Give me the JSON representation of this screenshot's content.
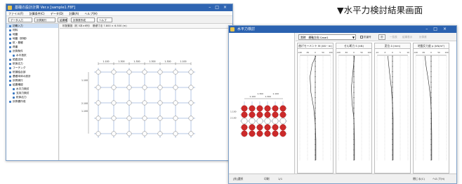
{
  "caption": "▼水平力検討結果画面",
  "main_window": {
    "title": "基礎の設計計算 Ver.x  [sample1.F8F]",
    "menu": [
      "ファイル(F)",
      "計算条件(C)",
      "データ(D)",
      "計算(A)",
      "ヘルプ(H)"
    ],
    "toolbar": [
      "データ入力",
      "計算実行",
      "結果確認",
      "計算書作成",
      "ヘルプ"
    ],
    "tree": [
      {
        "label": "初期入力",
        "selected": true,
        "indent": false
      },
      {
        "label": "材料",
        "indent": false
      },
      {
        "label": "地盤",
        "indent": false
      },
      {
        "label": "地盤（詳細）",
        "indent": false
      },
      {
        "label": "杭・基礎",
        "indent": false
      },
      {
        "label": "荷重",
        "indent": false
      },
      {
        "label": "計算条件",
        "indent": false
      },
      {
        "label": "水平抵抗",
        "indent": true
      },
      {
        "label": "鉛直支持",
        "indent": false
      },
      {
        "label": "杭体応力",
        "indent": false
      },
      {
        "label": "フーチング",
        "indent": false
      },
      {
        "label": "杭頭結合部",
        "indent": false
      },
      {
        "label": "基礎本体の設計",
        "indent": false
      },
      {
        "label": "計算実行",
        "indent": false
      },
      {
        "label": "結果確認",
        "indent": false
      },
      {
        "label": "水平力検討",
        "indent": true
      },
      {
        "label": "支持力検討",
        "indent": true
      },
      {
        "label": "杭体応力",
        "indent": true
      },
      {
        "label": "計算書作成",
        "indent": false
      }
    ],
    "canvas_header": "杭配置図（杭 5本×6列）　基礎寸法 7.800 × 6.500 (m)",
    "plan": {
      "top_dims": [
        "1.100",
        "1.300",
        "1.300",
        "1.300",
        "1.300",
        "1.100"
      ],
      "left_dims": [
        "1.100",
        "2.100",
        "1.100"
      ]
    }
  },
  "result_window": {
    "title": "水平力検討",
    "select_value": "常時　橋軸方向 Case1",
    "checkbox_label": "杭番号",
    "buttons": [
      "図",
      "一覧表",
      "結果表示",
      "計算書"
    ],
    "panels": [
      {
        "title": "曲げモーメント M (kN・m)",
        "scale": [
          "-100",
          "-50",
          "0",
          "50",
          "100"
        ]
      },
      {
        "title": "せん断力 S (kN)",
        "scale": [
          "-100",
          "-50",
          "0",
          "50",
          "100"
        ]
      },
      {
        "title": "変位 δ (mm)",
        "scale": [
          "-10",
          "-5",
          "0",
          "5",
          "10"
        ]
      },
      {
        "title": "地盤反力度 p (kN/m²)",
        "scale": [
          "-100",
          "-50",
          "0",
          "50",
          "100"
        ]
      }
    ],
    "pile_plan": {
      "top_dims": [
        "1.100",
        "1.300",
        "1.300",
        "1.100"
      ],
      "left_dims": [
        "1.100",
        "2.100"
      ],
      "rows": [
        {
          "state": "red",
          "count": 6
        },
        {
          "state": "red",
          "count": 6
        },
        {
          "state": "white",
          "count": 6
        },
        {
          "state": "red",
          "count": 6
        },
        {
          "state": "red",
          "count": 6
        }
      ]
    },
    "status": {
      "left": "[杭]選択",
      "middle": "印刷",
      "page": "1/1",
      "right_a": "閉じる(C)",
      "right_b": "ヘルプ(H)"
    },
    "accent": "#cc2a2a"
  }
}
